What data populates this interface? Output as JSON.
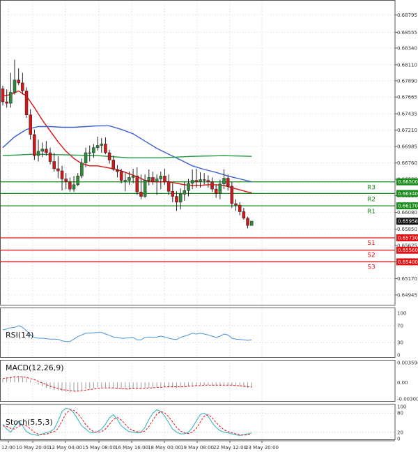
{
  "chart_data": {
    "type": "candlestick",
    "price_axis": {
      "ylim": [
        0.648,
        0.69
      ],
      "tick_labels": [
        "0.68795",
        "0.68555",
        "0.68340",
        "0.68110",
        "0.67890",
        "0.67665",
        "0.67435",
        "0.67210",
        "0.66985",
        "0.66760",
        "0.66535",
        "0.66310",
        "0.66080",
        "0.65850",
        "0.65625",
        "0.65400",
        "0.65170",
        "0.64945"
      ]
    },
    "current_price": {
      "label": "0.65958",
      "value": 0.65958
    },
    "levels": [
      {
        "name": "R3",
        "value": 0.665,
        "label": "0.66500",
        "color": "#1a8c1a"
      },
      {
        "name": "R2",
        "value": 0.6634,
        "label": "0.66340",
        "color": "#1a8c1a"
      },
      {
        "name": "R1",
        "value": 0.6617,
        "label": "0.66170",
        "color": "#1a8c1a"
      },
      {
        "name": "S1",
        "value": 0.6573,
        "label": "0.65730",
        "color": "#e01010"
      },
      {
        "name": "S2",
        "value": 0.6556,
        "label": "0.65560",
        "color": "#e01010"
      },
      {
        "name": "S3",
        "value": 0.654,
        "label": "0.65400",
        "color": "#e01010"
      }
    ],
    "x_tick_labels": [
      "12:00",
      "10 May 20:00",
      "12 May 04:00",
      "15 May 08:00",
      "16 May 16:00",
      "18 May 00:00",
      "19 May 08:00",
      "22 May 12:00",
      "23 May 20:00"
    ],
    "candles": {
      "open": [
        0.6778,
        0.676,
        0.6758,
        0.6773,
        0.679,
        0.6786,
        0.6775,
        0.6742,
        0.6715,
        0.6686,
        0.6692,
        0.6695,
        0.669,
        0.6678,
        0.6668,
        0.6665,
        0.6654,
        0.665,
        0.664,
        0.6646,
        0.6658,
        0.6676,
        0.669,
        0.669,
        0.6697,
        0.67,
        0.6702,
        0.669,
        0.668,
        0.6667,
        0.6664,
        0.6652,
        0.6652,
        0.6656,
        0.6658,
        0.6636,
        0.663,
        0.6652,
        0.6656,
        0.665,
        0.6654,
        0.6658,
        0.665,
        0.6637,
        0.663,
        0.6622,
        0.6633,
        0.6638,
        0.6648,
        0.6652,
        0.665,
        0.6653,
        0.6652,
        0.665,
        0.664,
        0.6634,
        0.6647,
        0.6655,
        0.6644,
        0.662,
        0.6618,
        0.6609,
        0.66,
        0.659
      ],
      "high": [
        0.6782,
        0.6777,
        0.68,
        0.6818,
        0.6806,
        0.68,
        0.678,
        0.675,
        0.6722,
        0.6708,
        0.6704,
        0.6706,
        0.6697,
        0.669,
        0.6685,
        0.6672,
        0.6662,
        0.6656,
        0.6658,
        0.6662,
        0.6682,
        0.6697,
        0.67,
        0.6702,
        0.6712,
        0.671,
        0.6711,
        0.6694,
        0.6686,
        0.6673,
        0.6668,
        0.6662,
        0.6664,
        0.6668,
        0.667,
        0.666,
        0.666,
        0.6667,
        0.6664,
        0.666,
        0.6664,
        0.6668,
        0.666,
        0.6648,
        0.6637,
        0.6641,
        0.665,
        0.6654,
        0.6667,
        0.6668,
        0.6663,
        0.6662,
        0.6659,
        0.6656,
        0.6646,
        0.6653,
        0.6667,
        0.666,
        0.665,
        0.6626,
        0.6622,
        0.6614,
        0.6602,
        0.6594
      ],
      "low": [
        0.6755,
        0.6752,
        0.6752,
        0.677,
        0.6783,
        0.677,
        0.6738,
        0.6708,
        0.668,
        0.6678,
        0.6684,
        0.6686,
        0.6674,
        0.6664,
        0.6655,
        0.6638,
        0.664,
        0.6636,
        0.6636,
        0.6644,
        0.6655,
        0.667,
        0.6678,
        0.6683,
        0.6693,
        0.669,
        0.6688,
        0.6675,
        0.6665,
        0.6656,
        0.6648,
        0.6637,
        0.6646,
        0.6648,
        0.6632,
        0.6626,
        0.6628,
        0.6645,
        0.6646,
        0.6632,
        0.664,
        0.6646,
        0.6632,
        0.6622,
        0.661,
        0.6612,
        0.6624,
        0.663,
        0.664,
        0.6642,
        0.6642,
        0.6646,
        0.6642,
        0.6636,
        0.6628,
        0.6626,
        0.664,
        0.6638,
        0.6614,
        0.661,
        0.6604,
        0.6598,
        0.6586,
        0.6592
      ],
      "close": [
        0.676,
        0.6758,
        0.6773,
        0.679,
        0.6786,
        0.6775,
        0.6742,
        0.6715,
        0.6686,
        0.6692,
        0.6695,
        0.669,
        0.6678,
        0.6668,
        0.6665,
        0.6654,
        0.665,
        0.664,
        0.6646,
        0.6658,
        0.6676,
        0.669,
        0.669,
        0.6697,
        0.67,
        0.6702,
        0.669,
        0.668,
        0.6667,
        0.6664,
        0.6652,
        0.6652,
        0.6656,
        0.6658,
        0.6636,
        0.663,
        0.6652,
        0.6656,
        0.665,
        0.6654,
        0.6658,
        0.665,
        0.6637,
        0.663,
        0.6622,
        0.6633,
        0.6638,
        0.6648,
        0.6652,
        0.665,
        0.6653,
        0.6652,
        0.665,
        0.664,
        0.6634,
        0.6647,
        0.6655,
        0.6644,
        0.662,
        0.6618,
        0.6609,
        0.66,
        0.659,
        0.6596
      ]
    },
    "moving_averages": [
      {
        "color": "#e01010",
        "x": [
          0,
          2,
          4,
          6,
          8,
          10,
          12,
          14,
          16,
          18,
          20,
          22,
          24,
          26,
          28,
          30,
          32,
          34,
          36,
          38,
          40,
          42,
          44,
          46,
          48,
          50,
          52,
          54,
          56,
          58,
          60,
          62,
          63
        ],
        "values": [
          0.6768,
          0.677,
          0.6775,
          0.6768,
          0.6752,
          0.6735,
          0.672,
          0.6705,
          0.6692,
          0.6682,
          0.6675,
          0.6672,
          0.6672,
          0.667,
          0.6668,
          0.6665,
          0.6661,
          0.6657,
          0.6652,
          0.665,
          0.665,
          0.665,
          0.6648,
          0.6646,
          0.6645,
          0.6645,
          0.6646,
          0.6646,
          0.6645,
          0.6642,
          0.6639,
          0.6636,
          0.6635
        ]
      },
      {
        "color": "#3a5fd0",
        "x": [
          0,
          3,
          6,
          9,
          12,
          15,
          18,
          21,
          24,
          27,
          30,
          33,
          36,
          39,
          42,
          45,
          48,
          51,
          54,
          57,
          60,
          63
        ],
        "values": [
          0.6697,
          0.6712,
          0.6722,
          0.6726,
          0.6726,
          0.6725,
          0.6725,
          0.6726,
          0.6727,
          0.6727,
          0.6722,
          0.6716,
          0.6706,
          0.6696,
          0.6688,
          0.668,
          0.6672,
          0.6667,
          0.6663,
          0.6658,
          0.6654,
          0.665
        ]
      },
      {
        "color": "#1f9a40",
        "x": [
          0,
          8,
          16,
          24,
          32,
          40,
          48,
          56,
          63
        ],
        "values": [
          0.6686,
          0.6688,
          0.6687,
          0.6686,
          0.6683,
          0.6683,
          0.6685,
          0.6686,
          0.6685
        ]
      }
    ],
    "rsi": {
      "label": "RSI(14)",
      "ylim": [
        0,
        100
      ],
      "tick_labels": [
        "100",
        "70",
        "30",
        "0"
      ],
      "color": "#4a90d8",
      "values": [
        60,
        62,
        65,
        66,
        70,
        66,
        58,
        48,
        42,
        40,
        40,
        39,
        38,
        38,
        37,
        34,
        32,
        32,
        38,
        44,
        48,
        52,
        52,
        53,
        54,
        54,
        50,
        47,
        43,
        42,
        40,
        40,
        41,
        42,
        36,
        36,
        42,
        43,
        42,
        43,
        45,
        43,
        40,
        38,
        37,
        42,
        45,
        48,
        52,
        50,
        52,
        50,
        48,
        45,
        42,
        45,
        50,
        48,
        40,
        38,
        37,
        36,
        35,
        36
      ]
    },
    "macd": {
      "label": "MACD(12,26,9)",
      "ylim": [
        -0.003005,
        0.003594
      ],
      "tick_labels": [
        "0.003594",
        "0.00",
        "-0.003005"
      ],
      "histogram": [
        0.0006,
        0.0008,
        0.001,
        0.0012,
        0.0012,
        0.0011,
        0.0008,
        0.0004,
        0.0,
        -0.0004,
        -0.0007,
        -0.001,
        -0.0012,
        -0.0014,
        -0.0015,
        -0.0016,
        -0.0017,
        -0.0018,
        -0.0017,
        -0.0016,
        -0.0014,
        -0.0012,
        -0.0011,
        -0.001,
        -0.0009,
        -0.0009,
        -0.0009,
        -0.001,
        -0.0011,
        -0.0012,
        -0.0013,
        -0.0013,
        -0.0012,
        -0.0011,
        -0.0012,
        -0.0012,
        -0.0011,
        -0.001,
        -0.001,
        -0.0009,
        -0.0008,
        -0.0008,
        -0.0009,
        -0.0009,
        -0.001,
        -0.0009,
        -0.0008,
        -0.0007,
        -0.0006,
        -0.0006,
        -0.0005,
        -0.0005,
        -0.0005,
        -0.0006,
        -0.0006,
        -0.0006,
        -0.0005,
        -0.0005,
        -0.0006,
        -0.0007,
        -0.0008,
        -0.0009,
        -0.001,
        -0.001
      ],
      "signal_color": "#e01010",
      "signal": [
        0.0007,
        0.0008,
        0.0009,
        0.001,
        0.001,
        0.001,
        0.0009,
        0.0007,
        0.0005,
        0.0002,
        -0.0001,
        -0.0004,
        -0.0007,
        -0.0009,
        -0.0011,
        -0.0013,
        -0.0014,
        -0.0015,
        -0.0016,
        -0.0016,
        -0.0015,
        -0.0014,
        -0.0013,
        -0.0012,
        -0.0011,
        -0.001,
        -0.001,
        -0.001,
        -0.001,
        -0.0011,
        -0.0011,
        -0.0012,
        -0.0012,
        -0.0011,
        -0.0011,
        -0.0011,
        -0.0011,
        -0.001,
        -0.001,
        -0.0009,
        -0.0009,
        -0.0008,
        -0.0008,
        -0.0008,
        -0.0008,
        -0.0008,
        -0.0008,
        -0.0007,
        -0.0007,
        -0.0006,
        -0.0006,
        -0.0005,
        -0.0005,
        -0.0005,
        -0.0005,
        -0.0005,
        -0.0005,
        -0.0005,
        -0.0005,
        -0.0006,
        -0.0006,
        -0.0007,
        -0.0008,
        -0.0008
      ]
    },
    "stochastic": {
      "label": "Stoch(5,5,3)",
      "ylim": [
        0,
        100
      ],
      "tick_labels": [
        "100",
        "80",
        "20",
        "0"
      ],
      "main_color": "#2ab0c0",
      "signal_color": "#e01010",
      "main": [
        45,
        30,
        20,
        38,
        55,
        40,
        22,
        15,
        12,
        10,
        15,
        18,
        22,
        30,
        55,
        85,
        95,
        92,
        80,
        60,
        40,
        30,
        20,
        18,
        22,
        30,
        45,
        65,
        75,
        60,
        40,
        30,
        22,
        20,
        18,
        20,
        35,
        60,
        80,
        90,
        85,
        70,
        50,
        30,
        20,
        15,
        15,
        20,
        35,
        55,
        75,
        80,
        70,
        50,
        35,
        25,
        20,
        18,
        15,
        12,
        10,
        12,
        15,
        18
      ],
      "signal": [
        40,
        38,
        32,
        30,
        38,
        44,
        40,
        30,
        20,
        14,
        12,
        14,
        18,
        22,
        32,
        55,
        78,
        90,
        88,
        78,
        62,
        44,
        30,
        22,
        20,
        22,
        30,
        45,
        60,
        66,
        58,
        45,
        32,
        25,
        22,
        20,
        24,
        38,
        58,
        76,
        85,
        80,
        68,
        52,
        35,
        24,
        18,
        16,
        20,
        32,
        52,
        70,
        75,
        65,
        50,
        38,
        28,
        22,
        18,
        15,
        12,
        11,
        12,
        14
      ]
    }
  }
}
